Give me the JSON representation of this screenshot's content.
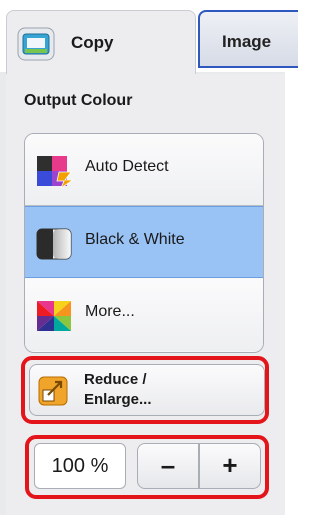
{
  "tabs": [
    {
      "label": "Copy",
      "icon": "copier-icon",
      "active": true
    },
    {
      "label": "Image",
      "active": false
    }
  ],
  "output_colour": {
    "title": "Output Colour",
    "options": [
      {
        "label": "Auto Detect",
        "icon": "auto-detect-colour-icon",
        "selected": false
      },
      {
        "label": "Black & White",
        "icon": "black-white-icon",
        "selected": true
      },
      {
        "label": "More...",
        "icon": "colour-more-icon",
        "selected": false
      }
    ]
  },
  "reduce_enlarge": {
    "line1": "Reduce /",
    "line2": "Enlarge...",
    "icon": "reduce-enlarge-icon"
  },
  "zoom": {
    "value": "100 %",
    "minus_label": "–",
    "plus_label": "+"
  },
  "colors": {
    "selection": "#9ac3f5",
    "highlight": "#e3141a",
    "tab_border": "#2f57c0"
  }
}
